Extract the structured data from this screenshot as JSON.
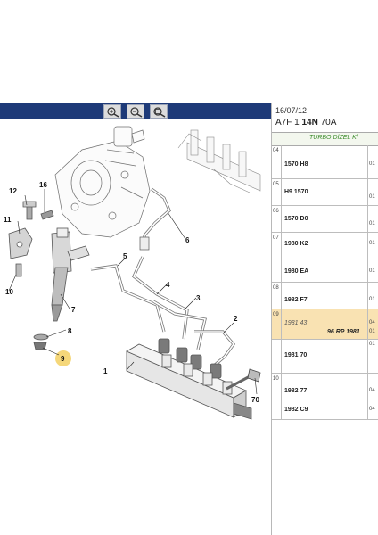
{
  "toolbar": {
    "buttons": [
      {
        "icon": "zoom-in-icon"
      },
      {
        "icon": "zoom-out-icon"
      },
      {
        "icon": "zoom-fit-icon"
      }
    ]
  },
  "diagram": {
    "callouts": {
      "c1": "1",
      "c2": "2",
      "c3": "3",
      "c4": "4",
      "c5": "5",
      "c6": "6",
      "c7": "7",
      "c8": "8",
      "c9": "9",
      "c10": "10",
      "c11": "11",
      "c12": "12",
      "c16": "16",
      "c70": "70"
    },
    "highlight_color": "#f5d77a"
  },
  "panel": {
    "date": "16/07/12",
    "ref_prefix": "A7F 1",
    "ref_bold": "14N",
    "ref_suffix": "70A",
    "subtitle": "TURBO DİZEL Kİ",
    "highlight_color": "#f9e2b2",
    "rows": [
      {
        "lvl": "04",
        "ref": "1570 H8",
        "ref2": "",
        "qty": [
          "01"
        ]
      },
      {
        "lvl": "05",
        "ref": "H9 1570",
        "ref2": "",
        "qty": [
          "",
          "01"
        ]
      },
      {
        "lvl": "06",
        "ref": "1570 D0",
        "ref2": "",
        "qty": [
          "",
          "01"
        ]
      },
      {
        "lvl": "07",
        "ref": "1980 K2",
        "ref2": "",
        "qty": [
          "01"
        ]
      },
      {
        "lvl": "",
        "ref": "1980 EA",
        "ref2": "",
        "qty": [
          "01"
        ]
      },
      {
        "lvl": "08",
        "ref": "1982 F7",
        "ref2": "",
        "qty": [
          "01"
        ]
      },
      {
        "lvl": "09",
        "ref": "1981 43",
        "ref2": "96 RP 1981",
        "qty": [
          "04",
          "01"
        ]
      },
      {
        "lvl": "",
        "ref": "1981 70",
        "ref2": "",
        "qty": [
          "01"
        ]
      },
      {
        "lvl": "10",
        "ref": "1982 77",
        "ref2": "",
        "qty": [
          "04"
        ]
      },
      {
        "lvl": "",
        "ref": "1982 C9",
        "ref2": "",
        "qty": [
          "04"
        ]
      }
    ]
  }
}
